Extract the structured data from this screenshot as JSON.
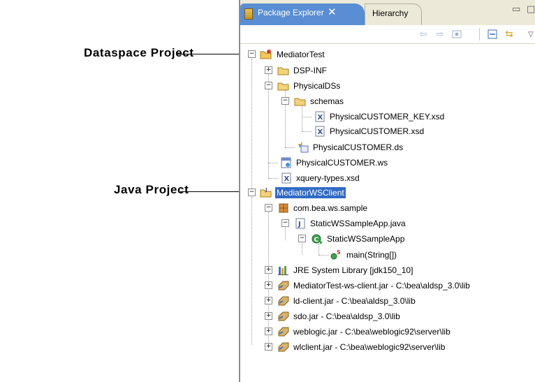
{
  "annotations": {
    "dataspace_project": "Dataspace Project",
    "java_project": "Java Project"
  },
  "tabs": {
    "active": "Package Explorer",
    "inactive": "Hierarchy"
  },
  "toolbar_icons": [
    "back-arrow-icon",
    "forward-arrow-icon",
    "go-up-icon",
    "collapse-all-icon",
    "link-with-editor-icon",
    "view-menu-icon"
  ],
  "tree": {
    "mediator_test": "MediatorTest",
    "dsp_inf": "DSP-INF",
    "physical_dss": "PhysicalDSs",
    "schemas": "schemas",
    "physical_customer_key_xsd": "PhysicalCUSTOMER_KEY.xsd",
    "physical_customer_xsd": "PhysicalCUSTOMER.xsd",
    "physical_customer_ds": "PhysicalCUSTOMER.ds",
    "physical_customer_ws": "PhysicalCUSTOMER.ws",
    "xquery_types": "xquery-types.xsd",
    "mediator_ws_client": "MediatorWSClient",
    "package": "com.bea.ws.sample",
    "java_file": "StaticWSSampleApp.java",
    "class": "StaticWSSampleApp",
    "method": "main(String[])",
    "jre": "JRE System Library [jdk150_10]",
    "jar1": "MediatorTest-ws-client.jar - C:\\bea\\aldsp_3.0\\lib",
    "jar2": "ld-client.jar - C:\\bea\\aldsp_3.0\\lib",
    "jar3": "sdo.jar - C:\\bea\\aldsp_3.0\\lib",
    "jar4": "weblogic.jar - C:\\bea\\weblogic92\\server\\lib",
    "jar5": "wlclient.jar - C:\\bea\\weblogic92\\server\\lib"
  }
}
